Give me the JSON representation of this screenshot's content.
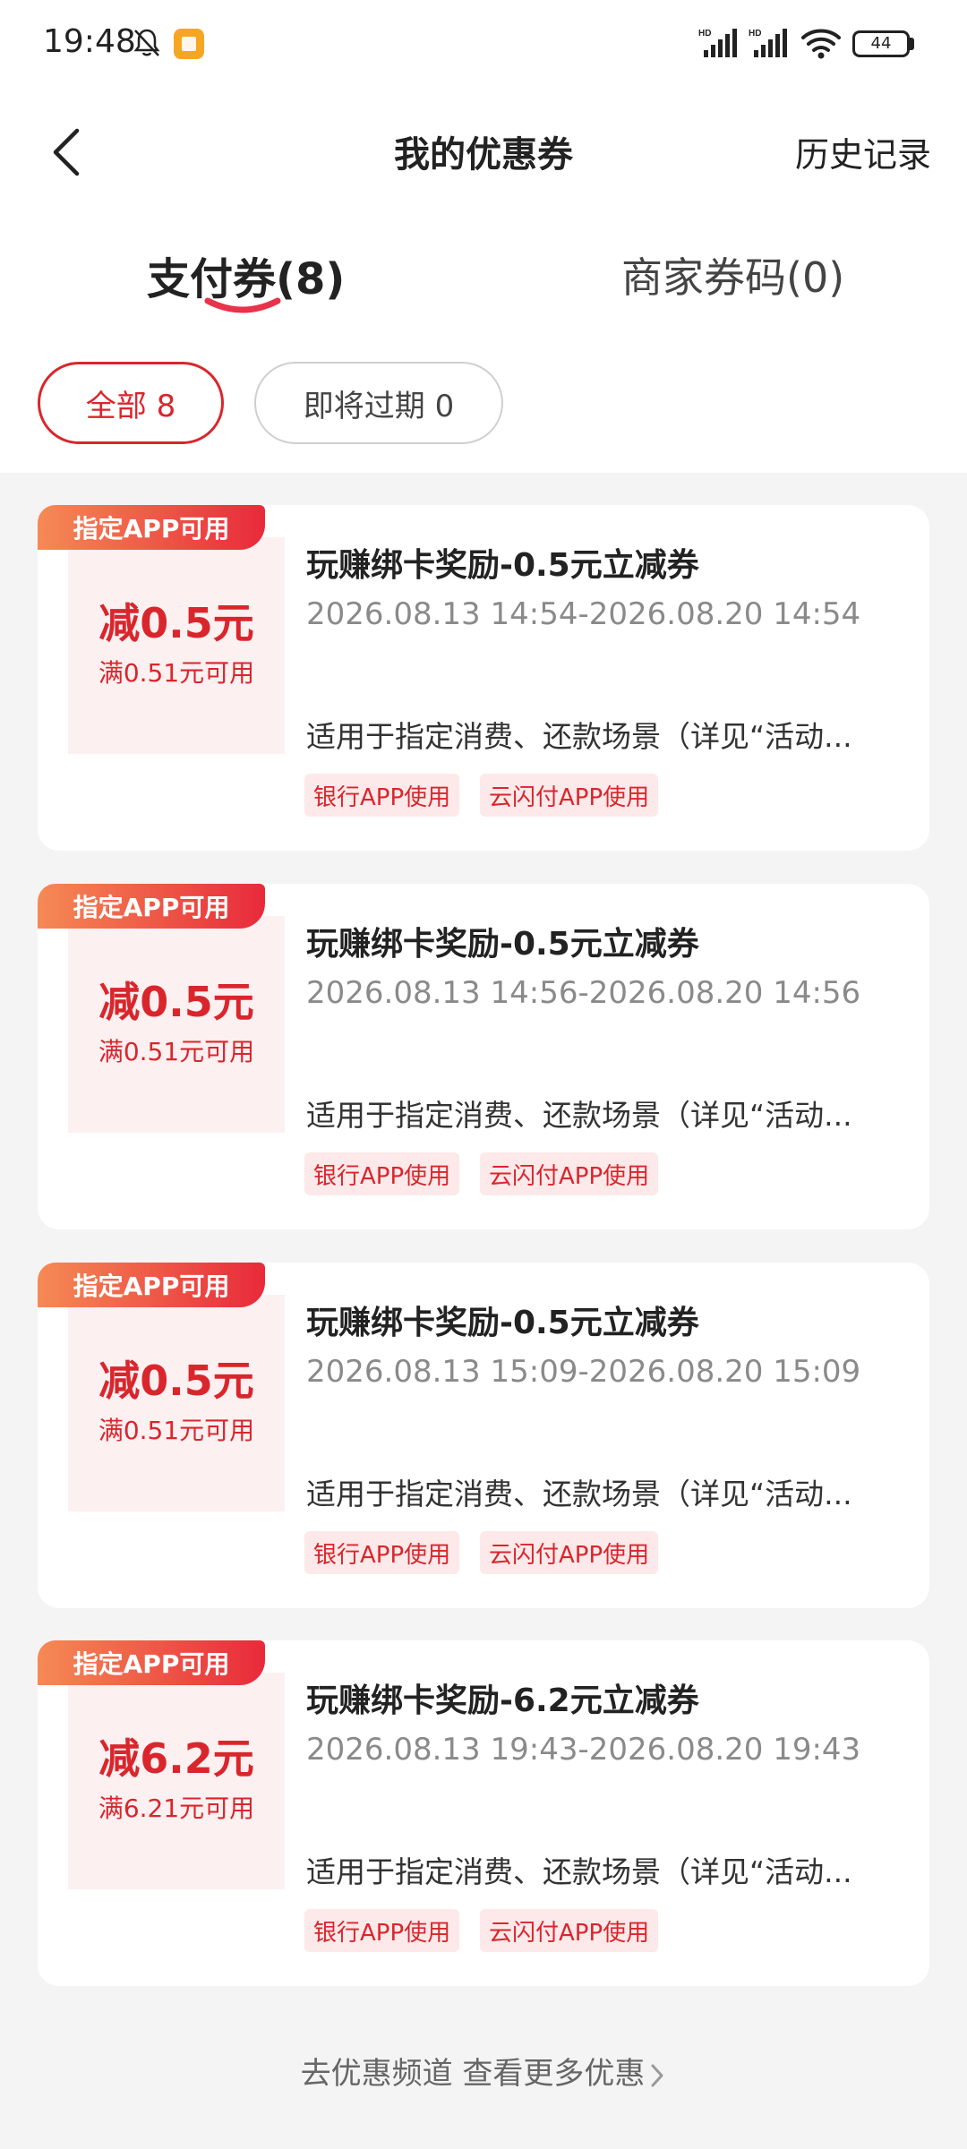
{
  "status": {
    "time": "19:48",
    "battery": "44",
    "signal_label": "HD"
  },
  "nav": {
    "title": "我的优惠券",
    "history": "历史记录"
  },
  "tabs": [
    {
      "label": "支付券(8)"
    },
    {
      "label": "商家券码(0)"
    }
  ],
  "filters": [
    {
      "label": "全部 8"
    },
    {
      "label": "即将过期 0"
    }
  ],
  "coupons": [
    {
      "ribbon": "指定APP可用",
      "amount": "减0.5元",
      "condition": "满0.51元可用",
      "title": "玩赚绑卡奖励-0.5元立减券",
      "period": "2026.08.13 14:54-2026.08.20 14:54",
      "desc": "适用于指定消费、还款场景（详见“活动...",
      "tags": [
        "银行APP使用",
        "云闪付APP使用"
      ]
    },
    {
      "ribbon": "指定APP可用",
      "amount": "减0.5元",
      "condition": "满0.51元可用",
      "title": "玩赚绑卡奖励-0.5元立减券",
      "period": "2026.08.13 14:56-2026.08.20 14:56",
      "desc": "适用于指定消费、还款场景（详见“活动...",
      "tags": [
        "银行APP使用",
        "云闪付APP使用"
      ]
    },
    {
      "ribbon": "指定APP可用",
      "amount": "减0.5元",
      "condition": "满0.51元可用",
      "title": "玩赚绑卡奖励-0.5元立减券",
      "period": "2026.08.13 15:09-2026.08.20 15:09",
      "desc": "适用于指定消费、还款场景（详见“活动...",
      "tags": [
        "银行APP使用",
        "云闪付APP使用"
      ]
    },
    {
      "ribbon": "指定APP可用",
      "amount": "减6.2元",
      "condition": "满6.21元可用",
      "title": "玩赚绑卡奖励-6.2元立减券",
      "period": "2026.08.13 19:43-2026.08.20 19:43",
      "desc": "适用于指定消费、还款场景（详见“活动...",
      "tags": [
        "银行APP使用",
        "云闪付APP使用"
      ]
    }
  ],
  "footer": {
    "more": "去优惠频道 查看更多优惠"
  },
  "colors": {
    "accent": "#d9262c",
    "ribbon_start": "#f58a55",
    "ribbon_end": "#e82a3a",
    "background": "#f4f4f4"
  }
}
